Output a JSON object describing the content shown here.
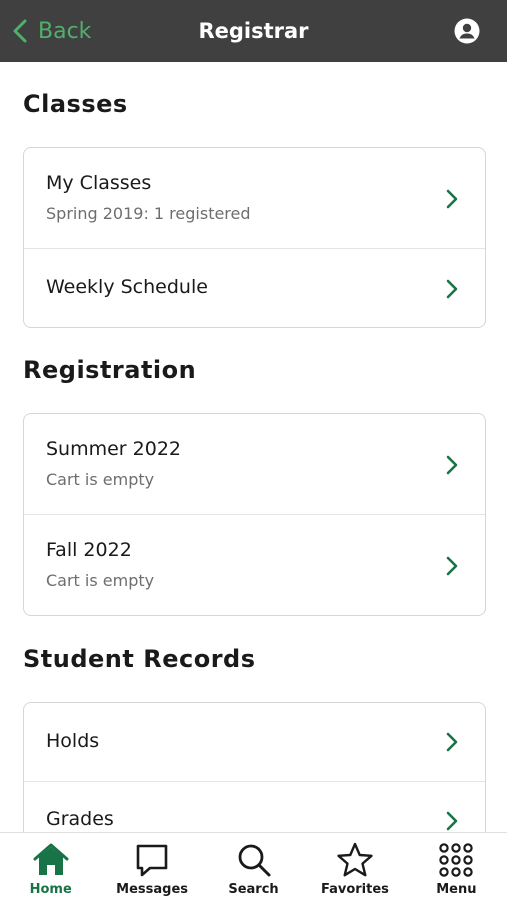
{
  "header": {
    "back_label": "Back",
    "title": "Registrar",
    "profile_icon": "user-circle-icon"
  },
  "sections": [
    {
      "title": "Classes",
      "rows": [
        {
          "label": "My Classes",
          "sub": "Spring 2019: 1 registered"
        },
        {
          "label": "Weekly Schedule"
        }
      ]
    },
    {
      "title": "Registration",
      "rows": [
        {
          "label": "Summer 2022",
          "sub": "Cart is empty"
        },
        {
          "label": "Fall 2022",
          "sub": "Cart is empty"
        }
      ]
    },
    {
      "title": "Student Records",
      "rows": [
        {
          "label": "Holds"
        },
        {
          "label": "Grades"
        }
      ]
    }
  ],
  "tabbar": {
    "items": [
      {
        "label": "Home",
        "icon": "home-icon",
        "active": true
      },
      {
        "label": "Messages",
        "icon": "chat-bubble-icon"
      },
      {
        "label": "Search",
        "icon": "search-icon"
      },
      {
        "label": "Favorites",
        "icon": "star-icon"
      },
      {
        "label": "Menu",
        "icon": "grid-menu-icon"
      }
    ]
  },
  "colors": {
    "header_bg": "#404040",
    "accent_green": "#187447",
    "back_green": "#4fb06b",
    "subtext_gray": "#6e6e6e"
  }
}
